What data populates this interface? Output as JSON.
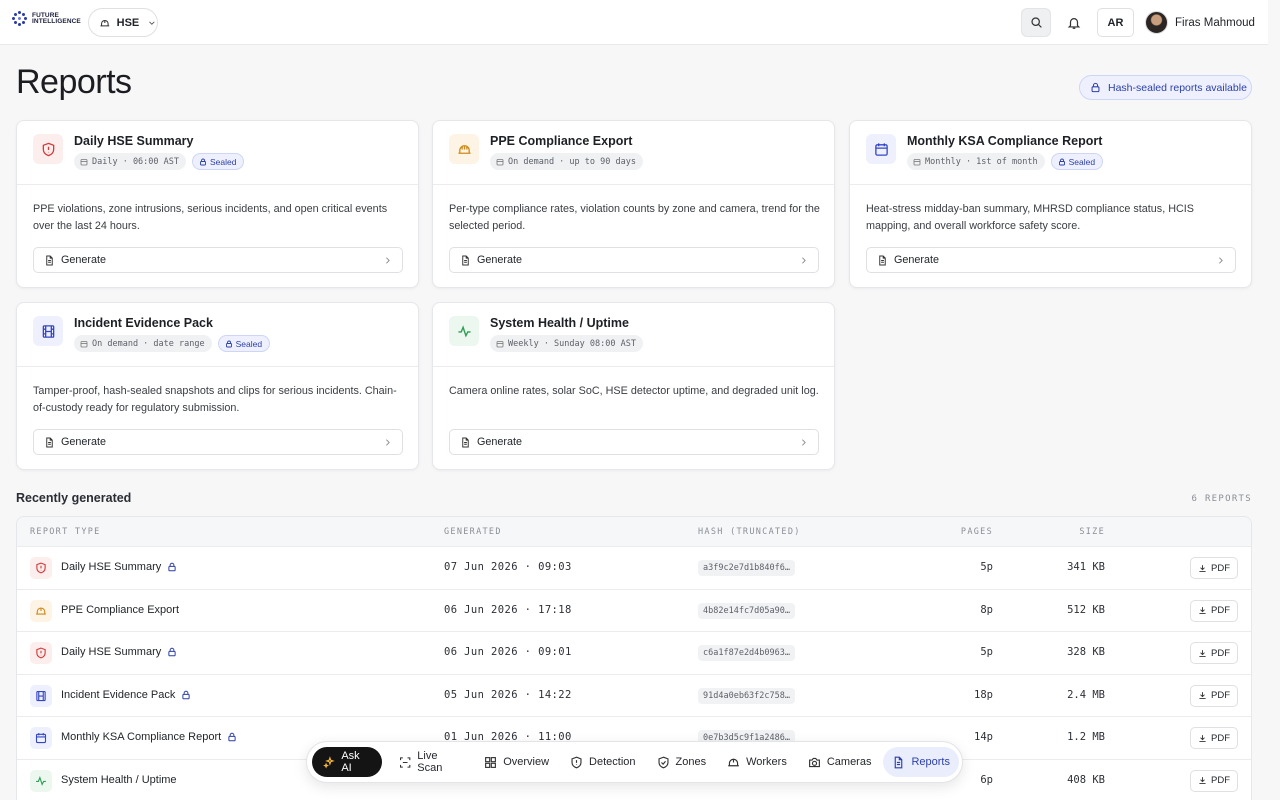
{
  "header": {
    "brand": "FUTURE INTELLIGENCE",
    "tenant": "HSE",
    "lang": "AR",
    "user_name": "Firas Mahmoud"
  },
  "page": {
    "title": "Reports",
    "sealed_note": "Hash-sealed reports available"
  },
  "cards": [
    {
      "title": "Daily HSE Summary",
      "schedule": "Daily · 06:00 AST",
      "sealed": "Sealed",
      "desc": "PPE violations, zone intrusions, serious incidents, and open critical events over the last 24 hours.",
      "action": "Generate",
      "icon": "shield-icon",
      "tone": "red"
    },
    {
      "title": "PPE Compliance Export",
      "schedule": "On demand · up to 90 days",
      "sealed": "",
      "desc": "Per-type compliance rates, violation counts by zone and camera, trend for the selected period.",
      "action": "Generate",
      "icon": "hardhat-icon",
      "tone": "amber"
    },
    {
      "title": "Monthly KSA Compliance Report",
      "schedule": "Monthly · 1st of month",
      "sealed": "Sealed",
      "desc": "Heat-stress midday-ban summary, MHRSD compliance status, HCIS mapping, and overall workforce safety score.",
      "action": "Generate",
      "icon": "calendar-icon",
      "tone": "blue"
    },
    {
      "title": "Incident Evidence Pack",
      "schedule": "On demand · date range",
      "sealed": "Sealed",
      "desc": "Tamper-proof, hash-sealed snapshots and clips for serious incidents. Chain-of-custody ready for regulatory submission.",
      "action": "Generate",
      "icon": "film-icon",
      "tone": "blue"
    },
    {
      "title": "System Health / Uptime",
      "schedule": "Weekly · Sunday 08:00 AST",
      "sealed": "",
      "desc": "Camera online rates, solar SoC, HSE detector uptime, and degraded unit log.",
      "action": "Generate",
      "icon": "activity-icon",
      "tone": "green"
    }
  ],
  "recent": {
    "title": "Recently generated",
    "count": "6 REPORTS",
    "columns": {
      "type": "REPORT TYPE",
      "generated": "GENERATED",
      "hash": "HASH (TRUNCATED)",
      "pages": "PAGES",
      "size": "SIZE"
    },
    "rows": [
      {
        "name": "Daily HSE Summary",
        "sealed": true,
        "generated": "07 Jun 2026 · 09:03",
        "hash": "a3f9c2e7d1b840f6…",
        "pages": "5p",
        "size": "341 KB",
        "action": "PDF",
        "icon": "shield-icon",
        "tone": "red"
      },
      {
        "name": "PPE Compliance Export",
        "sealed": false,
        "generated": "06 Jun 2026 · 17:18",
        "hash": "4b82e14fc7d05a90…",
        "pages": "8p",
        "size": "512 KB",
        "action": "PDF",
        "icon": "hardhat-icon",
        "tone": "amber"
      },
      {
        "name": "Daily HSE Summary",
        "sealed": true,
        "generated": "06 Jun 2026 · 09:01",
        "hash": "c6a1f87e2d4b0963…",
        "pages": "5p",
        "size": "328 KB",
        "action": "PDF",
        "icon": "shield-icon",
        "tone": "red"
      },
      {
        "name": "Incident Evidence Pack",
        "sealed": true,
        "generated": "05 Jun 2026 · 14:22",
        "hash": "91d4a0eb63f2c758…",
        "pages": "18p",
        "size": "2.4 MB",
        "action": "PDF",
        "icon": "film-icon",
        "tone": "blue"
      },
      {
        "name": "Monthly KSA Compliance Report",
        "sealed": true,
        "generated": "01 Jun 2026 · 11:00",
        "hash": "0e7b3d5c9f1a2486…",
        "pages": "14p",
        "size": "1.2 MB",
        "action": "PDF",
        "icon": "calendar-icon",
        "tone": "blue"
      },
      {
        "name": "System Health / Uptime",
        "sealed": false,
        "generated": "",
        "hash": "",
        "pages": "6p",
        "size": "408 KB",
        "action": "PDF",
        "icon": "activity-icon",
        "tone": "green"
      }
    ]
  },
  "dock": {
    "items": [
      {
        "label": "Ask AI",
        "icon": "sparkle-icon"
      },
      {
        "label": "Live Scan",
        "icon": "scan-icon"
      },
      {
        "label": "Overview",
        "icon": "grid-icon"
      },
      {
        "label": "Detection",
        "icon": "shield-icon"
      },
      {
        "label": "Zones",
        "icon": "shield-check-icon"
      },
      {
        "label": "Workers",
        "icon": "hardhat-icon"
      },
      {
        "label": "Cameras",
        "icon": "camera-icon"
      },
      {
        "label": "Reports",
        "icon": "file-icon"
      }
    ],
    "active": "Reports"
  },
  "colors": {
    "accent": "#2c3fa8",
    "red": "#d23b3b",
    "amber": "#d08a1c",
    "blue": "#3446c4",
    "green": "#2e9e55"
  }
}
